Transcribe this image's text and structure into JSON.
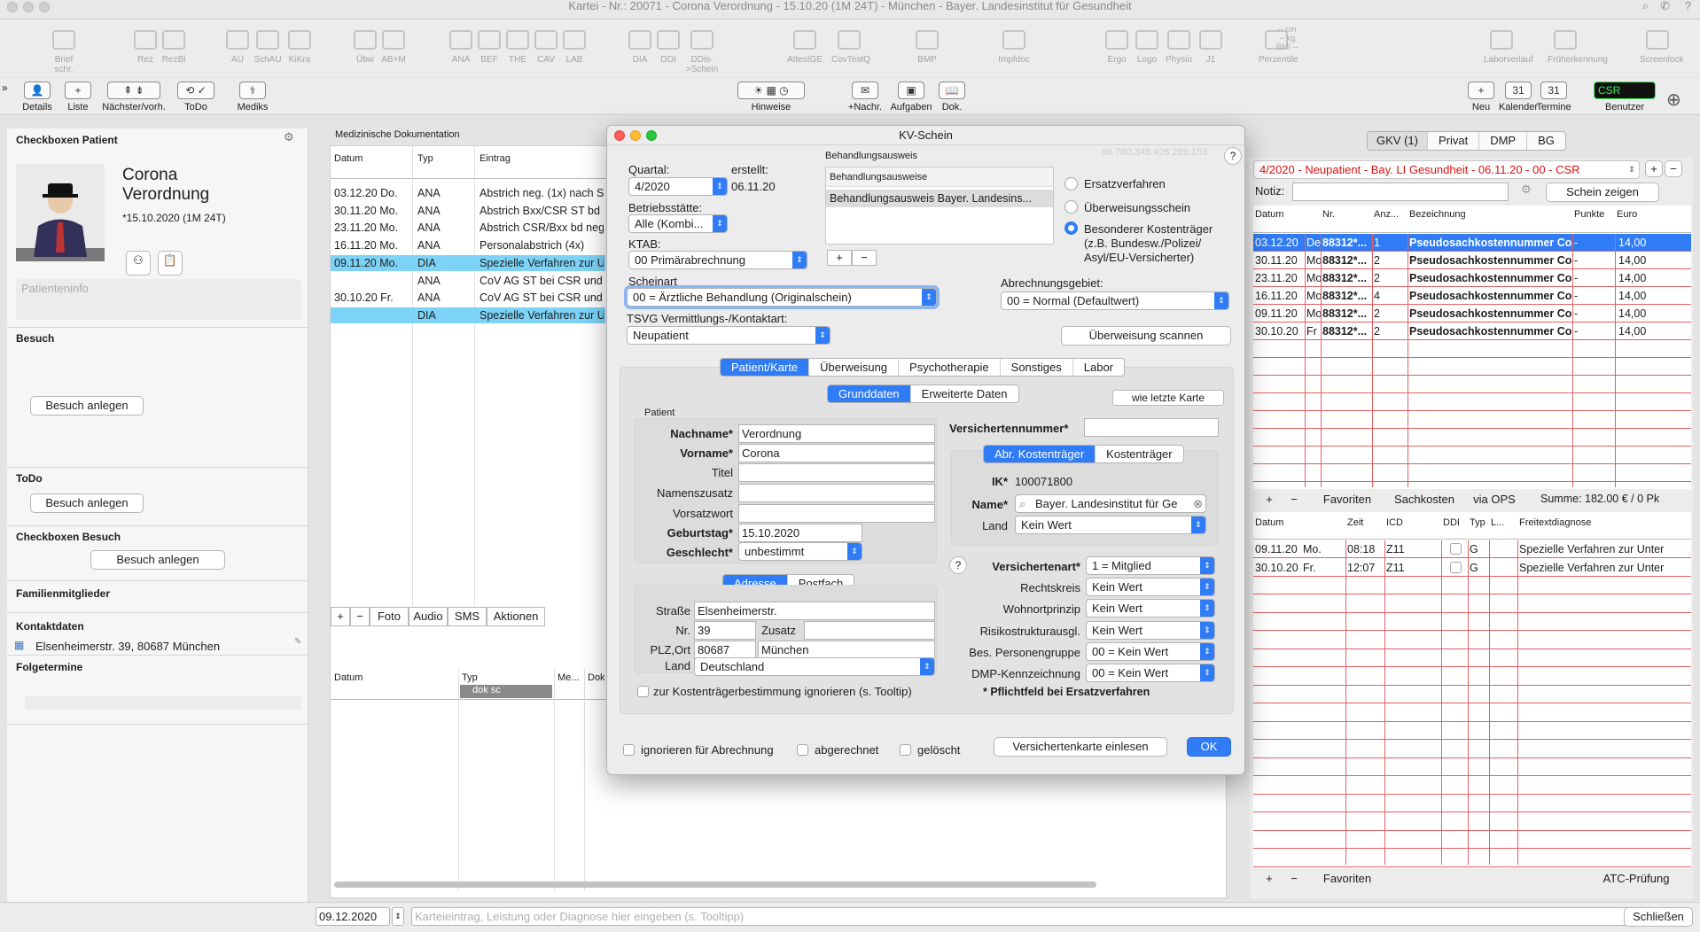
{
  "window": {
    "title": "Kartei - Nr.: 20071 - Corona Verordnung - 15.10.20 (1M 24T) - München - Bayer. Landesinstitut für Gesundheit"
  },
  "toolbar": {
    "items": [
      {
        "label": "Brief schr.",
        "icon": "letter-icon"
      },
      {
        "label": "Rez",
        "icon": "prescription-icon"
      },
      {
        "label": "RezBl",
        "icon": "prescription-blank-icon"
      },
      {
        "label": "AU",
        "icon": "sick-note-icon"
      },
      {
        "label": "SchAU",
        "icon": "school-sick-note-icon"
      },
      {
        "label": "KiKra",
        "icon": "child-sick-icon"
      },
      {
        "label": "Übw",
        "icon": "referral-icon"
      },
      {
        "label": "AB+M",
        "icon": "ab-m-icon"
      },
      {
        "label": "ANA",
        "icon": "stethoscope-icon"
      },
      {
        "label": "BEF",
        "icon": "findings-icon"
      },
      {
        "label": "THE",
        "icon": "therapy-icon"
      },
      {
        "label": "CAV",
        "icon": "cave-icon"
      },
      {
        "label": "LAB",
        "icon": "lab-icon"
      },
      {
        "label": "DIA",
        "icon": "diagnosis-icon"
      },
      {
        "label": "DDI",
        "icon": "ddi-icon"
      },
      {
        "label": "DDis->Schein",
        "icon": "ddis-schein-icon"
      },
      {
        "label": "AttestGE",
        "icon": "attest-icon"
      },
      {
        "label": "CovTestQ",
        "icon": "covtest-icon"
      },
      {
        "label": "BMP",
        "icon": "bmp-icon"
      },
      {
        "label": "Impfdoc",
        "icon": "syringe-icon"
      },
      {
        "label": "Ergo",
        "icon": "ergo-icon"
      },
      {
        "label": "Logo",
        "icon": "logo-therapy-icon"
      },
      {
        "label": "Physio",
        "icon": "physio-icon"
      },
      {
        "label": "J1",
        "icon": "j1-icon"
      },
      {
        "label": "Perzentile",
        "icon": "percentile-icon"
      },
      {
        "label": "Laborverlauf",
        "icon": "flask-icon"
      },
      {
        "label": "Früherkennung",
        "icon": "globe-icon"
      },
      {
        "label": "Screenlock",
        "icon": "screenlock-icon"
      }
    ],
    "perz": "-- cm\n-- kg\nBMI --"
  },
  "toolbar2": {
    "details": "Details",
    "liste": "Liste",
    "naechster": "Nächster/vorh.",
    "todo": "ToDo",
    "mediks": "Mediks",
    "hinweise": "Hinweise",
    "nachr": "+Nachr.",
    "aufgaben": "Aufgaben",
    "dok": "Dok.",
    "neu": "Neu",
    "kalender": "Kalender",
    "termine": "Termine",
    "benutzer": "Benutzer",
    "csr": "CSR",
    "kal_day": "31"
  },
  "left": {
    "title": "Checkboxen Patient",
    "patient_name": "Corona\nVerordnung",
    "dob": "*15.10.2020 (1M 24T)",
    "patienteninfo": "Patienteninfo",
    "besuch": "Besuch",
    "besuch_btn": "Besuch anlegen",
    "todo": "ToDo",
    "todo_btn": "Besuch anlegen",
    "cb_besuch": "Checkboxen Besuch",
    "cb_besuch_btn": "Besuch anlegen",
    "familie": "Familienmitglieder",
    "kontakt": "Kontaktdaten",
    "address": "Elsenheimerstr. 39, 80687 München",
    "folge": "Folgetermine"
  },
  "center": {
    "title": "Medizinische Dokumentation",
    "cols": [
      "Datum",
      "Typ",
      "Eintrag"
    ],
    "rows": [
      [
        "03.12.20 Do.",
        "ANA",
        "Abstrich neg. (1x) nach S"
      ],
      [
        "30.11.20 Mo.",
        "ANA",
        "Abstrich Bxx/CSR ST bd"
      ],
      [
        "23.11.20 Mo.",
        "ANA",
        "Abstrich CSR/Bxx bd neg"
      ],
      [
        "16.11.20 Mo.",
        "ANA",
        "Personalabstrich (4x)"
      ],
      [
        "09.11.20 Mo.",
        "DIA",
        "Spezielle Verfahren zur U"
      ],
      [
        "",
        "ANA",
        "CoV AG ST bei CSR und"
      ],
      [
        "30.10.20 Fr.",
        "ANA",
        "CoV AG ST bei CSR und"
      ],
      [
        "",
        "DIA",
        "Spezielle Verfahren zur U"
      ]
    ],
    "actions": [
      "+",
      "−",
      "Foto",
      "Audio",
      "SMS",
      "Aktionen"
    ],
    "cols2": [
      "Datum",
      "Typ",
      "Me...",
      "Dok"
    ],
    "filter": "dok sc"
  },
  "right": {
    "tabs": [
      "GKV (1)",
      "Privat",
      "DMP",
      "BG"
    ],
    "schein": "4/2020 - Neupatient - Bay. LI Gesundheit - 06.11.20 - 00 - CSR",
    "notiz": "Notiz:",
    "schein_btn": "Schein zeigen",
    "cols": [
      "Datum",
      "Nr.",
      "Anz...",
      "Bezeichnung",
      "Punkte",
      "Euro"
    ],
    "rows": [
      [
        "03.12.20",
        "De",
        "88312*...",
        "1",
        "Pseudosachkostennummer Co...",
        "-",
        "14,00"
      ],
      [
        "30.11.20",
        "Mo",
        "88312*...",
        "2",
        "Pseudosachkostennummer Co...",
        "-",
        "14,00"
      ],
      [
        "23.11.20",
        "Mo",
        "88312*...",
        "2",
        "Pseudosachkostennummer Co...",
        "-",
        "14,00"
      ],
      [
        "16.11.20",
        "Mo",
        "88312*...",
        "4",
        "Pseudosachkostennummer Co...",
        "-",
        "14,00"
      ],
      [
        "09.11.20",
        "Mo",
        "88312*...",
        "2",
        "Pseudosachkostennummer Co...",
        "-",
        "14,00"
      ],
      [
        "30.10.20",
        "Fr",
        "88312*...",
        "2",
        "Pseudosachkostennummer Co...",
        "-",
        "14,00"
      ]
    ],
    "bar1": [
      "+",
      "−",
      "Favoriten",
      "Sachkosten",
      "via OPS"
    ],
    "summe": "Summe: 182.00 € / 0 Pk",
    "cols2": [
      "Datum",
      "Zeit",
      "ICD",
      "DDI",
      "Typ",
      "L...",
      "Freitextdiagnose"
    ],
    "rows2": [
      [
        "09.11.20",
        "Mo.",
        "08:18",
        "Z11",
        "G",
        "Spezielle Verfahren zur Unter"
      ],
      [
        "30.10.20",
        "Fr.",
        "12:07",
        "Z11",
        "G",
        "Spezielle Verfahren zur Unter"
      ]
    ],
    "bar2": [
      "+",
      "−",
      "Favoriten"
    ],
    "atc": "ATC-Prüfung"
  },
  "dialog": {
    "title": "KV-Schein",
    "ip": "96.780.348.426.289.153",
    "quartal_lbl": "Quartal:",
    "quartal": "4/2020",
    "erstellt_lbl": "erstellt:",
    "erstellt": "06.11.20",
    "bst_lbl": "Betriebsstätte:",
    "bst": "Alle (Kombi...",
    "ktab_lbl": "KTAB:",
    "ktab": "00 Primärabrechnung",
    "ba_lbl": "Behandlungsausweis",
    "ba_head": "Behandlungsausweise",
    "ba_item": "Behandlungsausweis Bayer. Landesins...",
    "r1": "Ersatzverfahren",
    "r2": "Überweisungsschein",
    "r3": "Besonderer Kostenträger\n(z.B. Bundesw./Polizei/\nAsyl/EU-Versicherter)",
    "scheinart_lbl": "Scheinart",
    "scheinart": "00 = Ärztliche Behandlung (Originalschein)",
    "abrg_lbl": "Abrechnungsgebiet:",
    "abrg": "00 = Normal (Defaultwert)",
    "tsvg_lbl": "TSVG Vermittlungs-/Kontaktart:",
    "tsvg": "Neupatient",
    "ueb_scan": "Überweisung scannen",
    "tabs": [
      "Patient/Karte",
      "Überweisung",
      "Psychotherapie",
      "Sonstiges",
      "Labor"
    ],
    "subtabs": [
      "Grunddaten",
      "Erweiterte Daten"
    ],
    "wie_letzte": "wie letzte Karte",
    "patient_lbl": "Patient",
    "nachname_lbl": "Nachname*",
    "nachname": "Verordnung",
    "vorname_lbl": "Vorname*",
    "vorname": "Corona",
    "titel_lbl": "Titel",
    "nz_lbl": "Namenszusatz",
    "vsw_lbl": "Vorsatzwort",
    "geb_lbl": "Geburtstag*",
    "geb": "15.10.2020",
    "geschl_lbl": "Geschlecht*",
    "geschl": "unbestimmt",
    "addrtabs": [
      "Adresse",
      "Postfach"
    ],
    "strasse_lbl": "Straße",
    "strasse": "Elsenheimerstr.",
    "nr_lbl": "Nr.",
    "nr": "39",
    "zusatz_lbl": "Zusatz",
    "plz_lbl": "PLZ,Ort",
    "plz": "80687",
    "ort": "München",
    "land_lbl": "Land",
    "land": "Deutschland",
    "ignore_kt": "zur Kostenträgerbestimmung ignorieren (s. Tooltip)",
    "vnr_lbl": "Versichertennummer*",
    "kttabs": [
      "Abr. Kostenträger",
      "Kostenträger"
    ],
    "ik_lbl": "IK*",
    "ik": "100071800",
    "name_lbl": "Name*",
    "name": "Bayer. Landesinstitut für Ge",
    "kland_lbl": "Land",
    "kland": "Kein Wert",
    "va_lbl": "Versichertenart*",
    "va": "1 = Mitglied",
    "rk_lbl": "Rechtskreis",
    "rk": "Kein Wert",
    "wo_lbl": "Wohnortprinzip",
    "wo": "Kein Wert",
    "rsa_lbl": "Risikostrukturausgl.",
    "rsa": "Kein Wert",
    "bpg_lbl": "Bes. Personengruppe",
    "bpg": "00 = Kein Wert",
    "dmp_lbl": "DMP-Kennzeichnung",
    "dmp": "00 = Kein Wert",
    "pflicht": "* Pflichtfeld bei Ersatzverfahren",
    "ign_abr": "ignorieren für Abrechnung",
    "abger": "abgerechnet",
    "geloescht": "gelöscht",
    "vk_btn": "Versichertenkarte einlesen",
    "ok": "OK"
  },
  "bottom": {
    "date": "09.12.2020",
    "placeholder": "Karteieintrag, Leistung oder Diagnose hier eingeben (s. Tooltipp)",
    "close": "Schließen"
  }
}
